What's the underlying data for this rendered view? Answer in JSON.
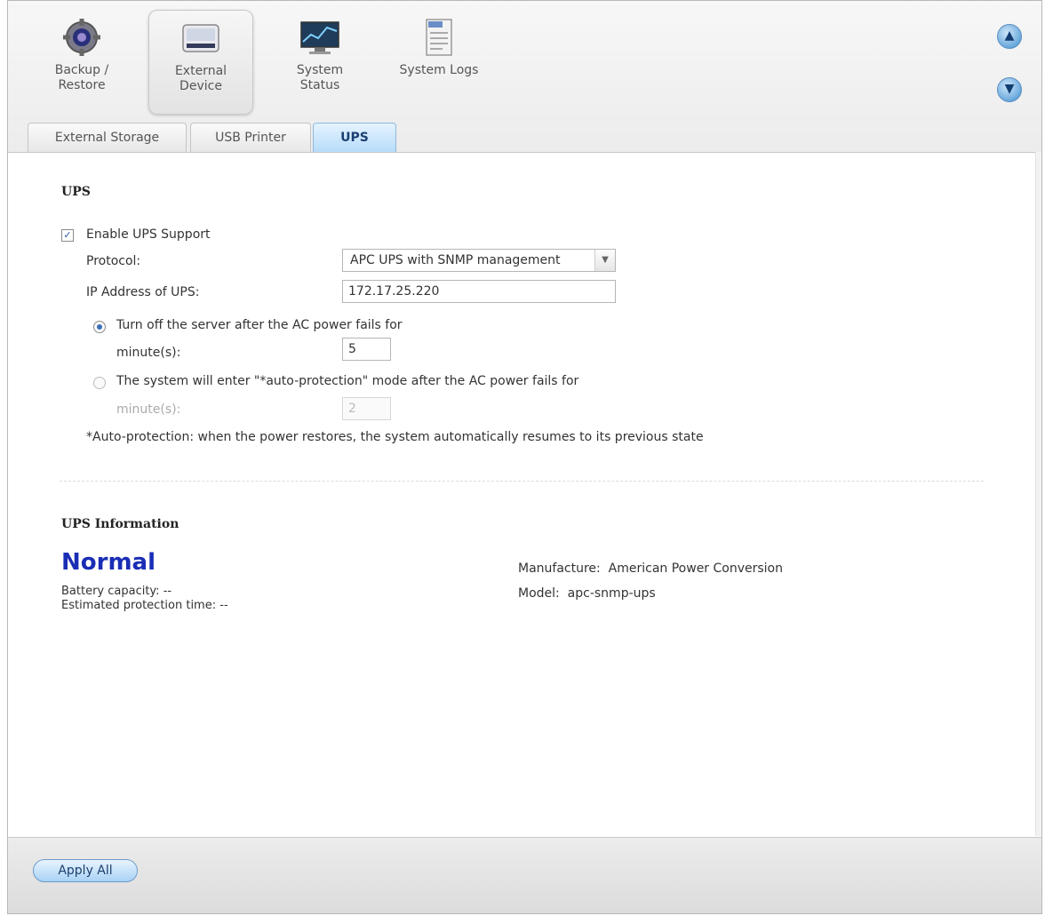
{
  "toolbar": {
    "tools": [
      {
        "label": "Backup /\nRestore",
        "icon": "gear-icon"
      },
      {
        "label": "External\nDevice",
        "icon": "drive-icon"
      },
      {
        "label": "System\nStatus",
        "icon": "monitor-icon"
      },
      {
        "label": "System Logs",
        "icon": "log-icon"
      }
    ],
    "nav_up": "^",
    "nav_down": "v"
  },
  "tabs": [
    {
      "label": "External Storage"
    },
    {
      "label": "USB Printer"
    },
    {
      "label": "UPS"
    }
  ],
  "ups": {
    "title": "UPS",
    "enable_label": "Enable UPS Support",
    "enable_checked": true,
    "protocol_label": "Protocol:",
    "protocol_value": "APC UPS with SNMP management",
    "ip_label": "IP Address of UPS:",
    "ip_value": "172.17.25.220",
    "turnoff_label": "Turn off the server after the AC power fails for",
    "turnoff_minutes_label": "minute(s):",
    "turnoff_minutes_value": "5",
    "autoprot_label": "The system will enter \"*auto-protection\" mode after the AC power fails for",
    "autoprot_minutes_label": "minute(s):",
    "autoprot_minutes_value": "2",
    "footnote": "*Auto-protection: when the power restores, the system automatically resumes to its previous state"
  },
  "info": {
    "title": "UPS Information",
    "status": "Normal",
    "battery_label": "Battery capacity:",
    "battery_value": "--",
    "protection_label": "Estimated protection time:",
    "protection_value": "--",
    "manufacture_label": "Manufacture:",
    "manufacture_value": "American Power Conversion",
    "model_label": "Model:",
    "model_value": "apc-snmp-ups"
  },
  "footer": {
    "apply_label": "Apply All"
  },
  "colors": {
    "status": "#1a2db5",
    "accent": "#6aa9dc"
  }
}
